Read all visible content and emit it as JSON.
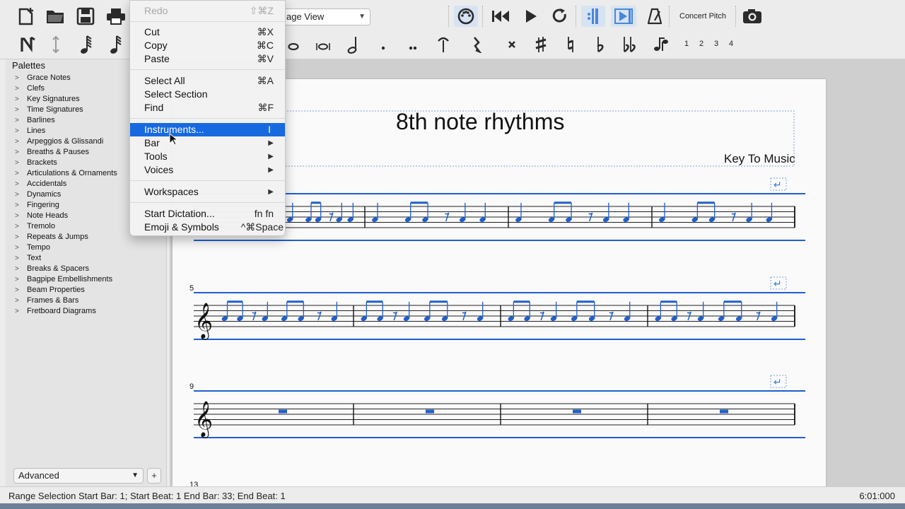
{
  "toolbar": {
    "view_mode": "age View",
    "concert_pitch_label": "Concert Pitch",
    "voice_numbers": [
      "1",
      "2",
      "3",
      "4"
    ]
  },
  "icons": [
    "new-score-icon",
    "open-file-icon",
    "save-icon",
    "print-icon",
    "note-input-icon",
    "toggle-icon",
    "sixty-fourth-note-icon",
    "thirty-second-note-icon",
    "whole-note-icon",
    "breve-icon",
    "half-note-icon",
    "augmentation-dot-icon",
    "double-dot-icon",
    "tie-icon",
    "rest-icon",
    "double-sharp-icon",
    "sharp-icon",
    "natural-icon",
    "flat-icon",
    "double-flat-icon",
    "flip-direction-icon",
    "midi-input-icon",
    "rewind-icon",
    "play-icon",
    "loop-icon",
    "play-repeats-icon",
    "pan-score-icon",
    "metronome-icon",
    "screenshot-icon"
  ],
  "palettes": {
    "title": "Palettes",
    "items": [
      "Grace Notes",
      "Clefs",
      "Key Signatures",
      "Time Signatures",
      "Barlines",
      "Lines",
      "Arpeggios & Glissandi",
      "Breaths & Pauses",
      "Brackets",
      "Articulations & Ornaments",
      "Accidentals",
      "Dynamics",
      "Fingering",
      "Note Heads",
      "Tremolo",
      "Repeats & Jumps",
      "Tempo",
      "Text",
      "Breaks & Spacers",
      "Bagpipe Embellishments",
      "Beam Properties",
      "Frames & Bars",
      "Fretboard Diagrams"
    ],
    "workspace": "Advanced",
    "add_label": "+"
  },
  "score": {
    "title": "8th note rhythms",
    "composer": "Key To Music",
    "system_numbers": [
      "5",
      "9",
      "13"
    ]
  },
  "menu": {
    "items": [
      {
        "label": "Redo",
        "shortcut": "⇧⌘Z",
        "disabled": true
      },
      {
        "label": "Cut",
        "shortcut": "⌘X"
      },
      {
        "label": "Copy",
        "shortcut": "⌘C"
      },
      {
        "label": "Paste",
        "shortcut": "⌘V"
      },
      {
        "label": "Select All",
        "shortcut": "⌘A"
      },
      {
        "label": "Select Section",
        "shortcut": ""
      },
      {
        "label": "Find",
        "shortcut": "⌘F"
      },
      {
        "label": "Instruments...",
        "shortcut": "I",
        "highlighted": true
      },
      {
        "label": "Bar",
        "shortcut": "",
        "submenu": true
      },
      {
        "label": "Tools",
        "shortcut": "",
        "submenu": true
      },
      {
        "label": "Voices",
        "shortcut": "",
        "submenu": true
      },
      {
        "label": "Workspaces",
        "shortcut": "",
        "submenu": true
      },
      {
        "label": "Start Dictation...",
        "shortcut": "fn fn"
      },
      {
        "label": "Emoji & Symbols",
        "shortcut": "^⌘Space"
      }
    ]
  },
  "status": {
    "selection": "Range Selection Start Bar: 1; Start Beat: 1 End Bar: 33; End Beat: 1",
    "time": "6:01:000"
  },
  "colors": {
    "accent": "#1769e0",
    "selection_blue": "#1f5fcc"
  }
}
